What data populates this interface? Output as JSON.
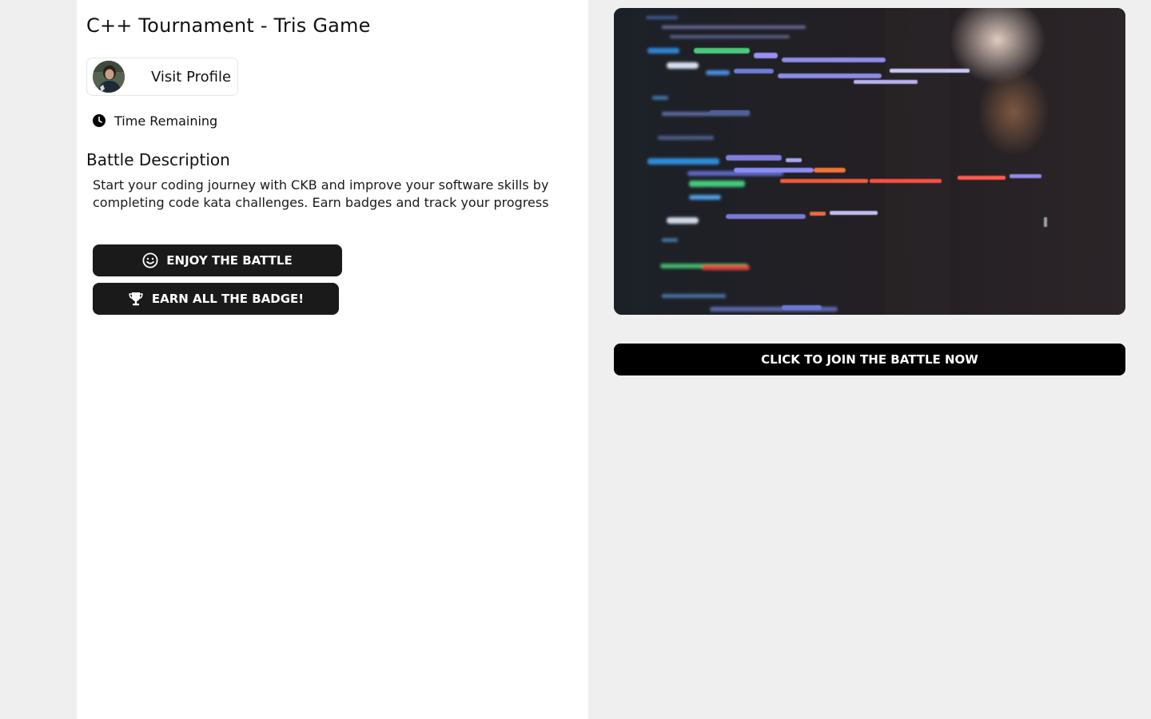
{
  "battle": {
    "title": "C++ Tournament - Tris Game",
    "profile_link": "Visit Profile",
    "time_label": "Time Remaining",
    "description_heading": "Battle Description",
    "description": "Start your coding journey with CKB and improve your software skills by completing code kata challenges. Earn badges and track your progress"
  },
  "actions": {
    "enjoy_label": "ENJOY THE BATTLE",
    "badge_label": "EARN ALL THE BADGE!",
    "join_label": "CLICK TO JOIN THE BATTLE NOW"
  },
  "icons": {
    "time": "clock-icon",
    "enjoy": "smiley-icon",
    "badge": "trophy-icon"
  },
  "colors": {
    "page_bg": "#efefef",
    "panel_bg": "#ffffff",
    "button_dark": "#1a1a1a",
    "join_button": "#000000"
  }
}
